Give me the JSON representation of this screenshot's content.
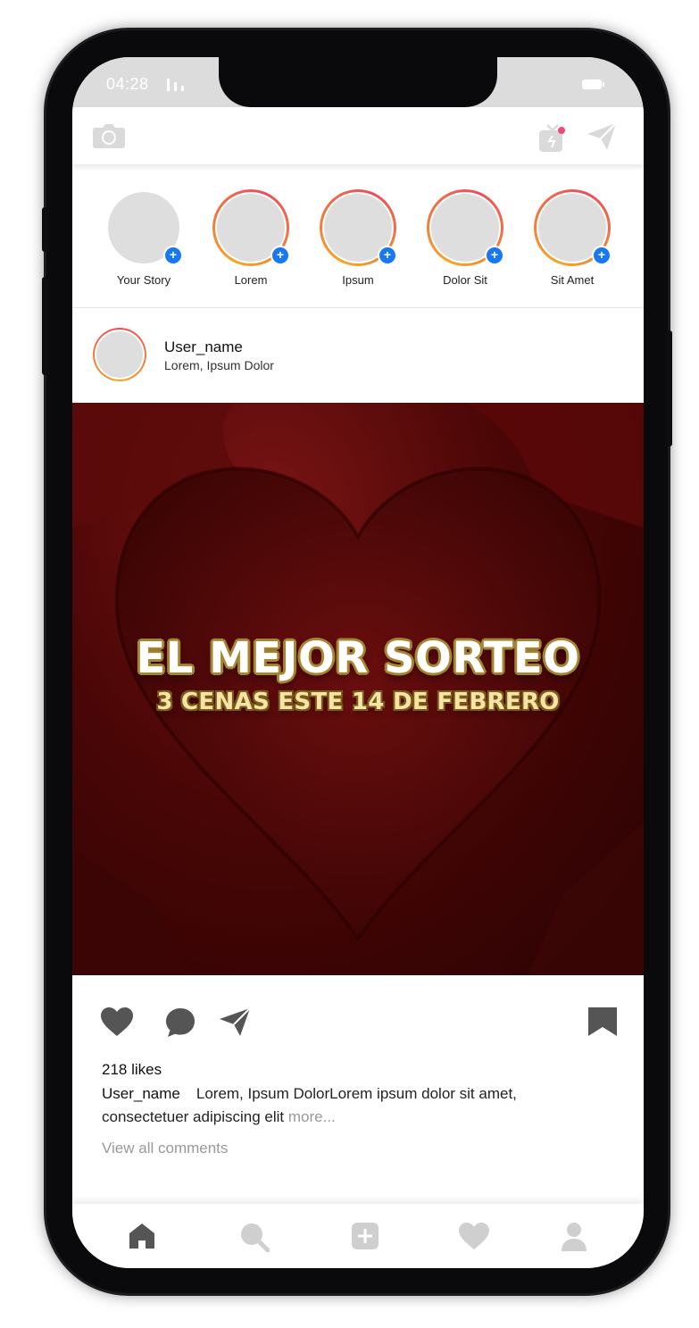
{
  "status_bar": {
    "time": "04:28"
  },
  "stories": [
    {
      "label": "Your Story"
    },
    {
      "label": "Lorem"
    },
    {
      "label": "Ipsum"
    },
    {
      "label": "Dolor Sit"
    },
    {
      "label": "Sit Amet"
    }
  ],
  "story_add_glyph": "+",
  "post": {
    "username": "User_name",
    "location": "Lorem, Ipsum Dolor",
    "headline": "EL MEJOR SORTEO",
    "subheadline": "3 CENAS ESTE 14 DE FEBRERO",
    "likes": "218 likes",
    "caption_user": "User_name",
    "caption_text": "Lorem, Ipsum DolorLorem ipsum dolor sit amet, consectetuer adipiscing elit",
    "caption_more": "more...",
    "view_comments": "View all comments"
  },
  "icons": {
    "top_left": "camera-icon",
    "top_right": [
      "igtv-icon",
      "direct-message-icon"
    ],
    "post_actions": [
      "like-icon",
      "comment-icon",
      "share-icon",
      "bookmark-icon"
    ],
    "bottom_nav": [
      "home-icon",
      "search-icon",
      "add-post-icon",
      "activity-icon",
      "profile-icon"
    ]
  },
  "colors": {
    "story_ring_start": "#f5a623",
    "story_ring_end": "#ef4b5c",
    "add_badge": "#1877f2",
    "notification_dot": "#ef4b7a",
    "headline_outline": "#a58532",
    "subheadline_fill": "#f6e4a6",
    "post_background": "#4a0606",
    "active_icon": "#555555",
    "inactive_icon": "#cfcfcf"
  }
}
